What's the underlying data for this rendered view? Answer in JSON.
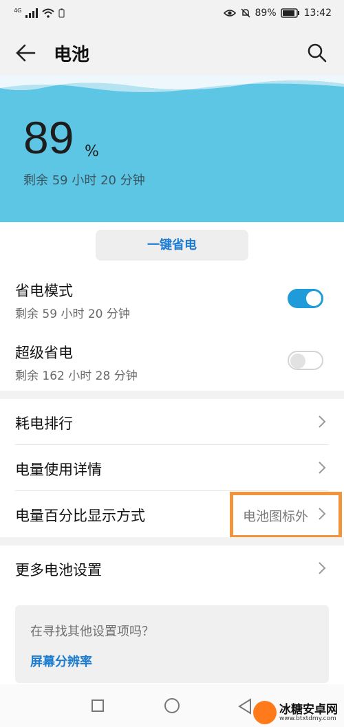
{
  "status_bar": {
    "network": "4G",
    "battery_pct": "89%",
    "time": "13:42"
  },
  "header": {
    "title": "电池"
  },
  "battery": {
    "level": "89",
    "level_unit": "%",
    "remaining": "剩余 59 小时 20 分钟"
  },
  "one_click": {
    "label": "一键省电"
  },
  "modes": [
    {
      "title": "省电模式",
      "subtitle": "剩余 59 小时 20 分钟",
      "enabled": true
    },
    {
      "title": "超级省电",
      "subtitle": "剩余 162 小时 28 分钟",
      "enabled": false
    }
  ],
  "settings": [
    {
      "label": "耗电排行"
    },
    {
      "label": "电量使用详情"
    },
    {
      "label": "电量百分比显示方式",
      "value": "电池图标外"
    }
  ],
  "more": {
    "label": "更多电池设置"
  },
  "suggestion": {
    "question": "在寻找其他设置项吗？",
    "link": "屏幕分辨率"
  },
  "watermark": {
    "name": "冰糖安卓网",
    "url": "www.btxtdmy.com"
  },
  "colors": {
    "banner": "#5dc6e4",
    "accent_blue": "#1d7ccf",
    "toggle_on": "#1e9bd8",
    "highlight_orange": "#f0953c"
  },
  "icons": [
    "back-arrow-icon",
    "search-icon",
    "chevron-right-icon",
    "eye-icon",
    "mute-bell-icon",
    "battery-icon",
    "wifi-icon",
    "signal-icon"
  ]
}
